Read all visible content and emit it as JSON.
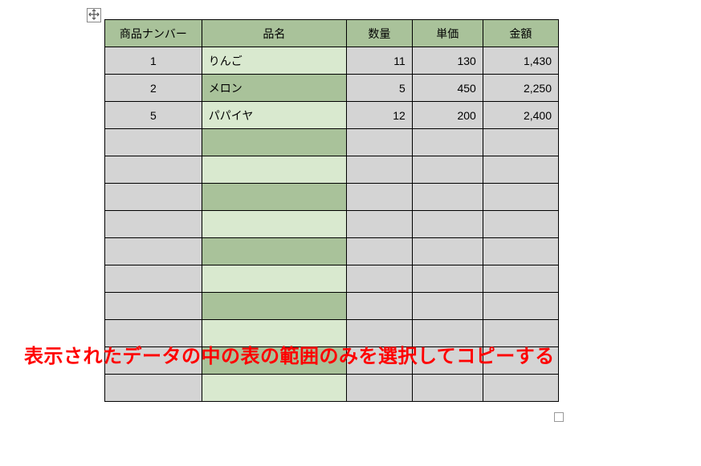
{
  "table": {
    "headers": {
      "num": "商品ナンバー",
      "name": "品名",
      "qty": "数量",
      "unit": "単価",
      "amt": "金額"
    },
    "rows": [
      {
        "num": "1",
        "name": "りんご",
        "qty": "11",
        "unit": "130",
        "amt": "1,430"
      },
      {
        "num": "2",
        "name": "メロン",
        "qty": "5",
        "unit": "450",
        "amt": "2,250"
      },
      {
        "num": "5",
        "name": "パパイヤ",
        "qty": "12",
        "unit": "200",
        "amt": "2,400"
      }
    ],
    "empty_row_count": 10
  },
  "annotation": "表示されたデータの中の表の範囲のみを選択してコピーする",
  "icons": {
    "move": "move-icon",
    "resize": "resize-icon"
  }
}
